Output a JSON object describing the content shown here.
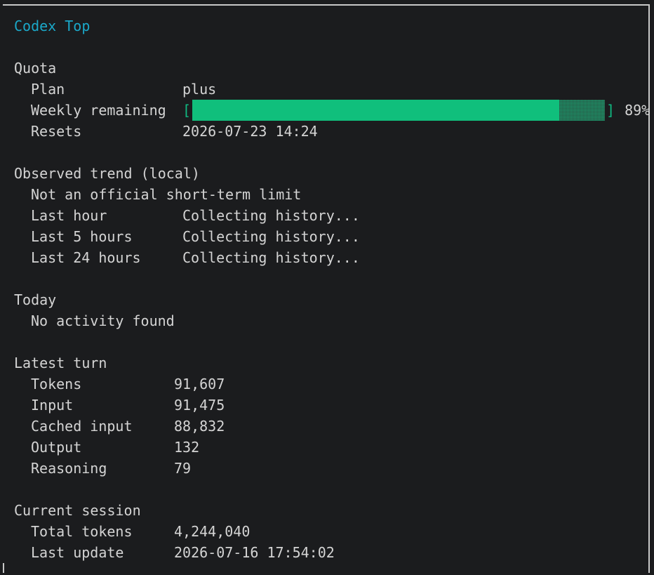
{
  "title": "Codex Top",
  "quota": {
    "heading": "Quota",
    "plan_label": "Plan",
    "plan_value": "plus",
    "weekly_label": "Weekly remaining",
    "bracket_open": "[",
    "bracket_close": "]",
    "weekly_fraction": 0.89,
    "weekly_percent": "89%",
    "resets_label": "Resets",
    "resets_value": "2026-07-23 14:24"
  },
  "trend": {
    "heading": "Observed trend (local)",
    "note": "Not an official short-term limit",
    "rows": [
      {
        "label": "Last hour",
        "value": "Collecting history..."
      },
      {
        "label": "Last 5 hours",
        "value": "Collecting history..."
      },
      {
        "label": "Last 24 hours",
        "value": "Collecting history..."
      }
    ]
  },
  "today": {
    "heading": "Today",
    "message": "No activity found"
  },
  "latest_turn": {
    "heading": "Latest turn",
    "rows": [
      {
        "label": "Tokens",
        "value": "91,607"
      },
      {
        "label": "Input",
        "value": "91,475"
      },
      {
        "label": "Cached input",
        "value": "88,832"
      },
      {
        "label": "Output",
        "value": "132"
      },
      {
        "label": "Reasoning",
        "value": "79"
      }
    ]
  },
  "session": {
    "heading": "Current session",
    "rows": [
      {
        "label": "Total tokens",
        "value": "4,244,040"
      },
      {
        "label": "Last update",
        "value": "2026-07-16 17:54:02"
      }
    ]
  },
  "colors": {
    "accent": "#1ba8c9",
    "bar": "#10bf7c",
    "text": "#d4d4d4",
    "background": "#1b1c1e"
  }
}
